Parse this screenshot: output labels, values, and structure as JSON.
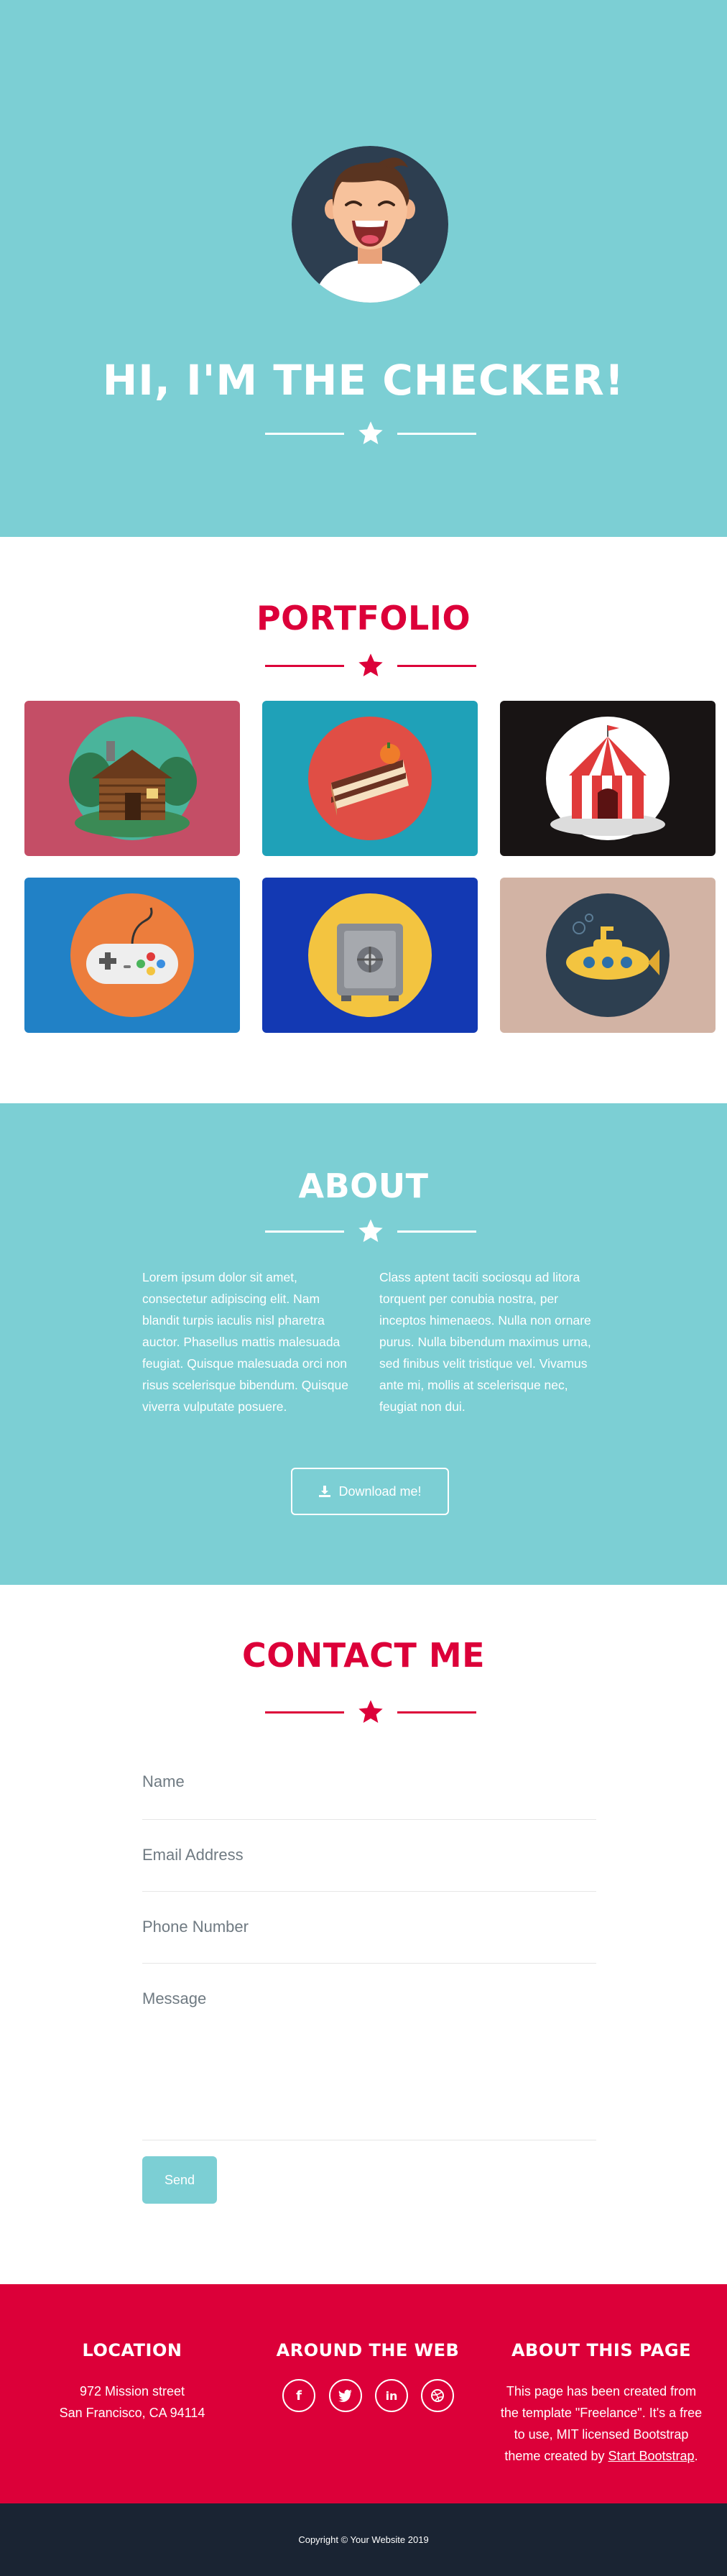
{
  "masthead": {
    "title": "HI, I'M THE CHECKER!"
  },
  "portfolio": {
    "title": "PORTFOLIO",
    "items": [
      {
        "icon": "log-cabin-icon",
        "bg": "#c44e66",
        "circle": "#4ab49b"
      },
      {
        "icon": "cake-slice-icon",
        "bg": "#1fa1b8",
        "circle": "#e04e45"
      },
      {
        "icon": "circus-tent-icon",
        "bg": "#181414",
        "circle": "#ffffff"
      },
      {
        "icon": "game-controller-icon",
        "bg": "#2181c6",
        "circle": "#ec7d3c"
      },
      {
        "icon": "safe-icon",
        "bg": "#1339b3",
        "circle": "#f3c440"
      },
      {
        "icon": "submarine-icon",
        "bg": "#d2b3a4",
        "circle": "#2d3f50"
      }
    ]
  },
  "about": {
    "title": "ABOUT",
    "left": "Lorem ipsum dolor sit amet, consectetur adipiscing elit. Nam blandit turpis iaculis nisl pharetra auctor. Phasellus mattis malesuada feugiat. Quisque malesuada orci non risus scelerisque bibendum. Quisque viverra vulputate posuere.",
    "right": "Class aptent taciti sociosqu ad litora torquent per conubia nostra, per inceptos himenaeos. Nulla non ornare purus. Nulla bibendum maximus urna, sed finibus velit tristique vel. Vivamus ante mi, mollis at scelerisque nec, feugiat non dui.",
    "button": "Download me!"
  },
  "contact": {
    "title": "CONTACT ME",
    "fields": [
      "Name",
      "Email Address",
      "Phone Number",
      "Message"
    ],
    "send": "Send"
  },
  "footer": {
    "location": {
      "title": "LOCATION",
      "line1": "972 Mission street",
      "line2": "San Francisco, CA 94114"
    },
    "web": {
      "title": "AROUND THE WEB",
      "social": [
        "facebook-icon",
        "twitter-icon",
        "linkedin-icon",
        "dribbble-icon"
      ]
    },
    "about_page": {
      "title": "ABOUT THIS PAGE",
      "line1": "This page has been created from",
      "line2": "the template \"Freelance\". It's a free",
      "line3": "to use, MIT licensed Bootstrap",
      "line4_prefix": "theme created by ",
      "link": "Start Bootstrap",
      "line4_suffix": "."
    }
  },
  "copyright": "Copyright © Your Website 2019",
  "colors": {
    "teal": "#7ccfd4",
    "red": "#dc0039",
    "dark": "#1a2433"
  }
}
